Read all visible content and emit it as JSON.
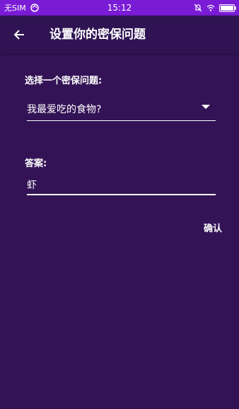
{
  "status_bar": {
    "carrier": "无SIM",
    "time": "15:12",
    "battery_level": 1.0,
    "icons": [
      "no-sim-sync-icon",
      "dnd-icon",
      "wifi-icon",
      "battery-icon"
    ]
  },
  "app_bar": {
    "title": "设置你的密保问题",
    "back_icon": "arrow-left-icon"
  },
  "form": {
    "question_label": "选择一个密保问题:",
    "question_value": "我最爱吃的食物?",
    "answer_label": "答案:",
    "answer_value": "虾"
  },
  "actions": {
    "confirm_label": "确认"
  },
  "colors": {
    "status_bar": "#7a1bd6",
    "app_bar": "#2f1353",
    "background": "#331356",
    "text": "#ffffff"
  }
}
